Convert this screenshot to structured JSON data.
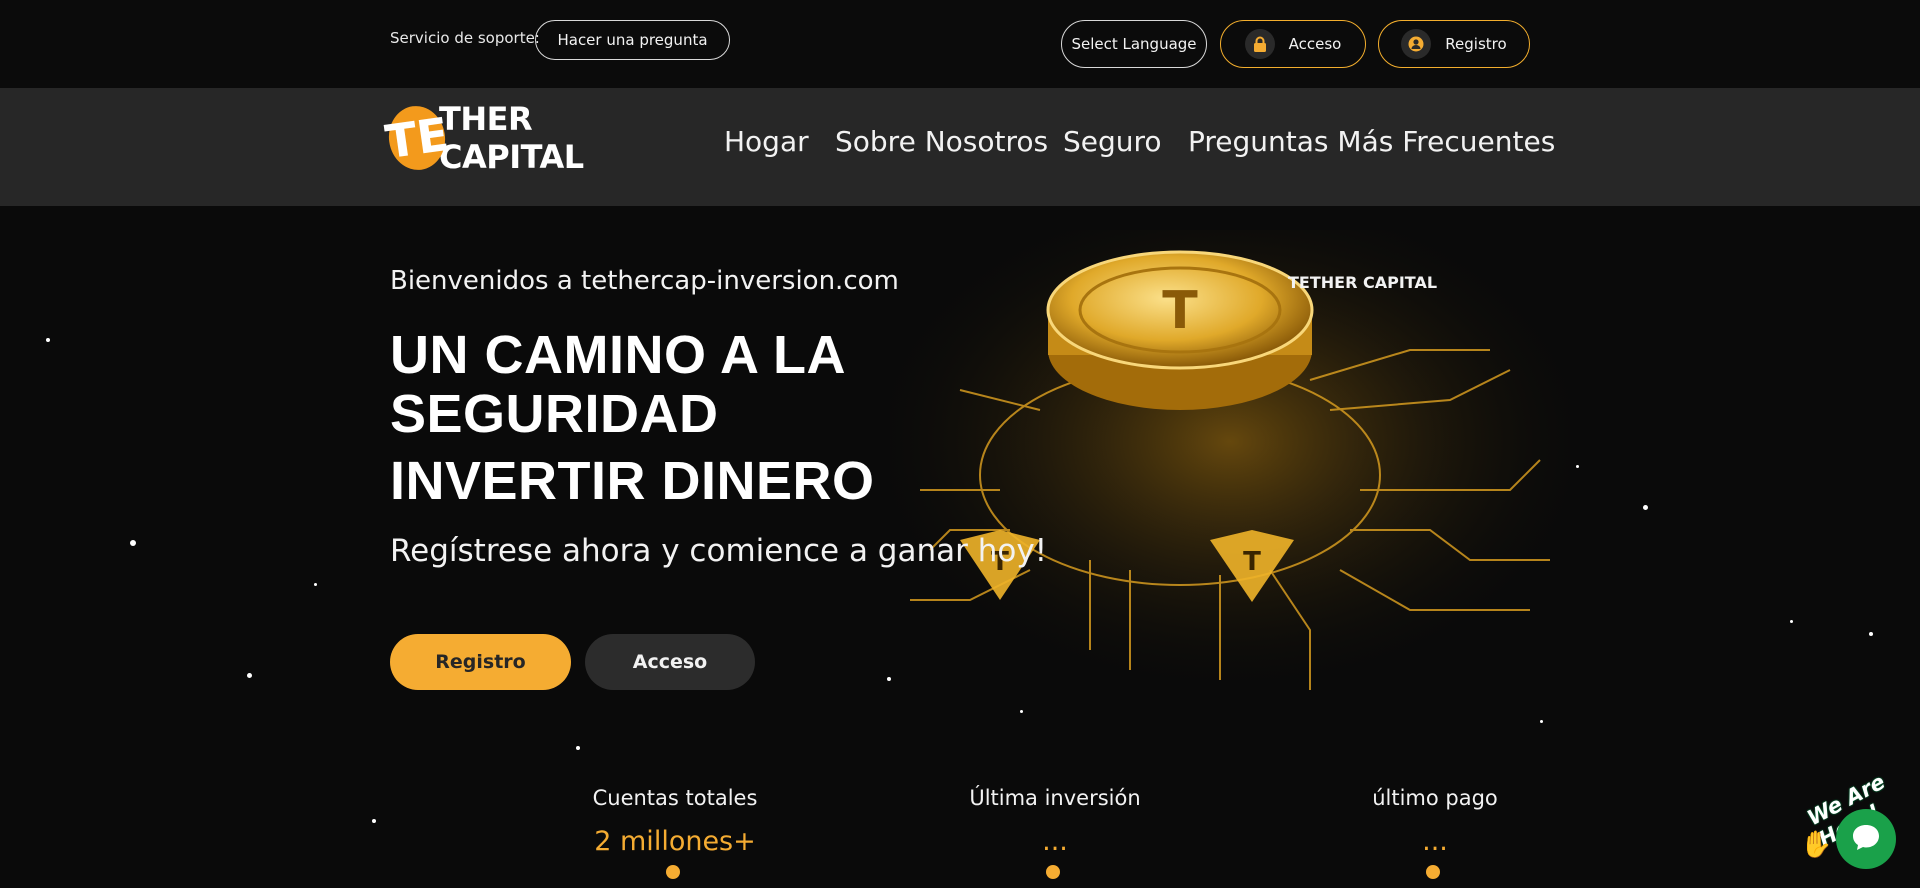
{
  "topbar": {
    "support_label": "Servicio de soporte:",
    "ask_button": "Hacer una pregunta",
    "language_button": "Select Language",
    "login_button": "Acceso",
    "register_button": "Registro"
  },
  "brand": {
    "logo_text": "THER CAPITAL",
    "logo_letter": "TE",
    "accent_color": "#f5ac32"
  },
  "nav": {
    "items": [
      "Hogar",
      "Sobre Nosotros",
      "Seguro",
      "Preguntas Más Frecuentes"
    ]
  },
  "hero": {
    "welcome": "Bienvenidos a tethercap-inversion.com",
    "headline_line1": "UN CAMINO A LA",
    "headline_line2": "SEGURIDAD",
    "headline_line3": "INVERTIR DINERO",
    "subtitle": "Regístrese ahora y comience a ganar hoy!",
    "register_button": "Registro",
    "login_button": "Acceso",
    "art_logo_text": "TETHER CAPITAL"
  },
  "stats": [
    {
      "title": "Cuentas totales",
      "value": "2 millones+"
    },
    {
      "title": "Última inversión",
      "value": "..."
    },
    {
      "title": "último pago",
      "value": "..."
    }
  ],
  "chat": {
    "bubble_text": "We Are Here!",
    "icon": "chat-icon",
    "color": "#1aa14a"
  }
}
